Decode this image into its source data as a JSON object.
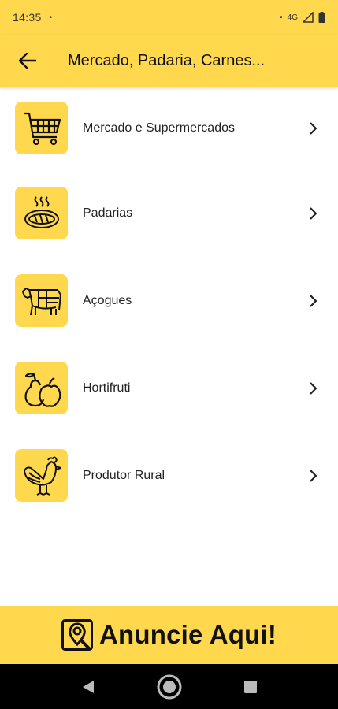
{
  "status_bar": {
    "time": "14:35",
    "network": "4G"
  },
  "app_bar": {
    "title": "Mercado, Padaria, Carnes..."
  },
  "categories": [
    {
      "label": "Mercado e Supermercados",
      "icon": "shopping-cart-icon"
    },
    {
      "label": "Padarias",
      "icon": "bread-icon"
    },
    {
      "label": "Açogues",
      "icon": "cow-icon"
    },
    {
      "label": "Hortifruti",
      "icon": "fruit-icon"
    },
    {
      "label": "Produtor Rural",
      "icon": "rooster-icon"
    }
  ],
  "banner": {
    "text": "Anuncie Aqui!",
    "icon": "map-pin-icon"
  },
  "colors": {
    "accent": "#FFD84D",
    "text": "#212121",
    "nav_bar": "#000000"
  }
}
